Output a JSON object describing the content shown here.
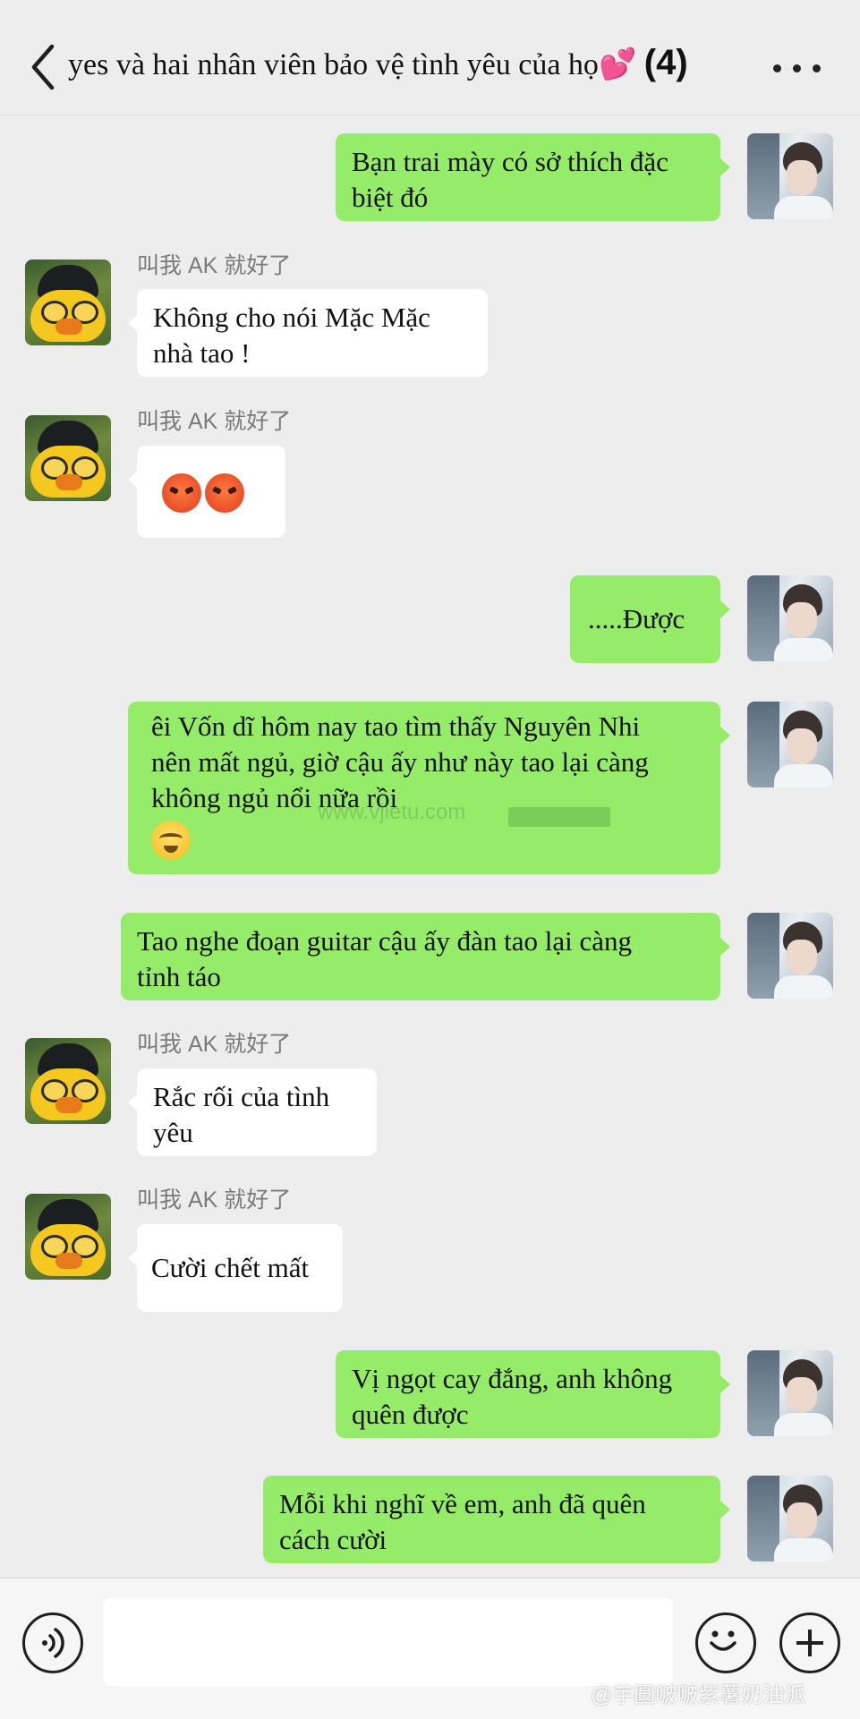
{
  "header": {
    "title": "yes và hai nhân viên bảo vệ tình yêu của họ",
    "heart_emoji": "💕",
    "member_count": "(4)"
  },
  "messages": [
    {
      "side": "out",
      "text_lines": [
        "Bạn trai mày có sở thích đặc",
        "biệt đó"
      ]
    },
    {
      "side": "in",
      "sender": "叫我 AK 就好了",
      "text_lines": [
        "Không cho nói Mặc Mặc",
        "nhà tao !"
      ]
    },
    {
      "side": "in",
      "sender": "叫我 AK 就好了",
      "emojis": [
        "angry-face-icon",
        "angry-face-icon"
      ]
    },
    {
      "side": "out",
      "text_lines": [
        ".....Được"
      ]
    },
    {
      "side": "out",
      "text_lines": [
        "ê",
        "i Vốn dĩ hôm nay tao tìm thấy Nguyên Nhi",
        "nên mất ngủ, giờ cậu ấy như này tao lại càng",
        "không ngủ nổi nữa rồi"
      ],
      "emojis": [
        "crying-face-icon"
      ]
    },
    {
      "side": "out",
      "text_lines": [
        "Tao nghe đoạn guitar cậu ấy đàn tao lại càng",
        "tỉnh táo"
      ]
    },
    {
      "side": "in",
      "sender": "叫我 AK 就好了",
      "text_lines": [
        "Rắc rối của tình",
        "yêu"
      ]
    },
    {
      "side": "in",
      "sender": "叫我 AK 就好了",
      "text_lines": [
        "Cười chết mất"
      ]
    },
    {
      "side": "out",
      "text_lines": [
        "Vị ngọt cay đắng, anh không",
        "quên được"
      ]
    },
    {
      "side": "out",
      "text_lines": [
        "Mỗi khi nghĩ về em, anh đã quên",
        "cách cười"
      ]
    }
  ],
  "watermarks": {
    "middle": "www.vjietu.com",
    "bottom": "@芋圆啵啵紫薯奶油派"
  },
  "input_bar": {
    "text_value": ""
  }
}
